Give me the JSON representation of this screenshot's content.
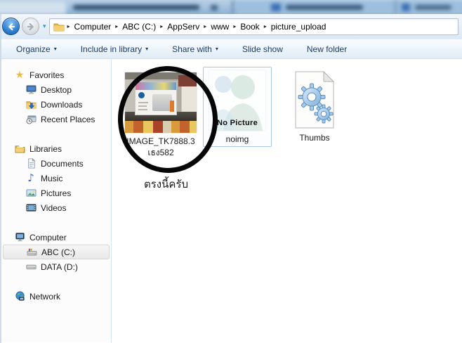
{
  "ui": {
    "breadcrumb_separator": "▸",
    "dropdown_arrow": "▾",
    "nav_dropdown_arrow": "▾",
    "music_note_glyph": "♪",
    "star_glyph": "★"
  },
  "colors": {
    "selection_border": "#a9c7e8",
    "annotation_circle": "#060606",
    "toolbar_text": "#1e3c64"
  },
  "address_bar": {
    "crumbs": [
      "Computer",
      "ABC (C:)",
      "AppServ",
      "www",
      "Book",
      "picture_upload"
    ]
  },
  "toolbar": {
    "items": [
      {
        "label": "Organize",
        "dropdown": true
      },
      {
        "label": "Include in library",
        "dropdown": true
      },
      {
        "label": "Share with",
        "dropdown": true
      },
      {
        "label": "Slide show",
        "dropdown": false
      },
      {
        "label": "New folder",
        "dropdown": false
      }
    ]
  },
  "sidebar": {
    "groups": [
      {
        "label": "Favorites",
        "icon": "star-icon",
        "items": [
          {
            "label": "Desktop",
            "icon": "desktop-icon"
          },
          {
            "label": "Downloads",
            "icon": "downloads-icon"
          },
          {
            "label": "Recent Places",
            "icon": "recent-places-icon"
          }
        ]
      },
      {
        "label": "Libraries",
        "icon": "libraries-icon",
        "items": [
          {
            "label": "Documents",
            "icon": "documents-icon"
          },
          {
            "label": "Music",
            "icon": "music-icon"
          },
          {
            "label": "Pictures",
            "icon": "pictures-icon"
          },
          {
            "label": "Videos",
            "icon": "videos-icon"
          }
        ]
      },
      {
        "label": "Computer",
        "icon": "computer-icon",
        "items": [
          {
            "label": "ABC (C:)",
            "icon": "system-drive-icon",
            "selected": true
          },
          {
            "label": "DATA (D:)",
            "icon": "hard-drive-icon"
          }
        ]
      },
      {
        "label": "Network",
        "icon": "network-icon",
        "items": []
      }
    ]
  },
  "files": [
    {
      "label": "IMAGE_TK7888.3",
      "label2": "เธง582",
      "type": "image"
    },
    {
      "label": "noimg",
      "placeholder_text": "No Picture",
      "type": "image",
      "selected": true
    },
    {
      "label": "Thumbs",
      "type": "system-file"
    }
  ],
  "annotation": {
    "caption": "ตรงนี้ครับ",
    "circled_file": "IMAGE_TK7888.3"
  }
}
